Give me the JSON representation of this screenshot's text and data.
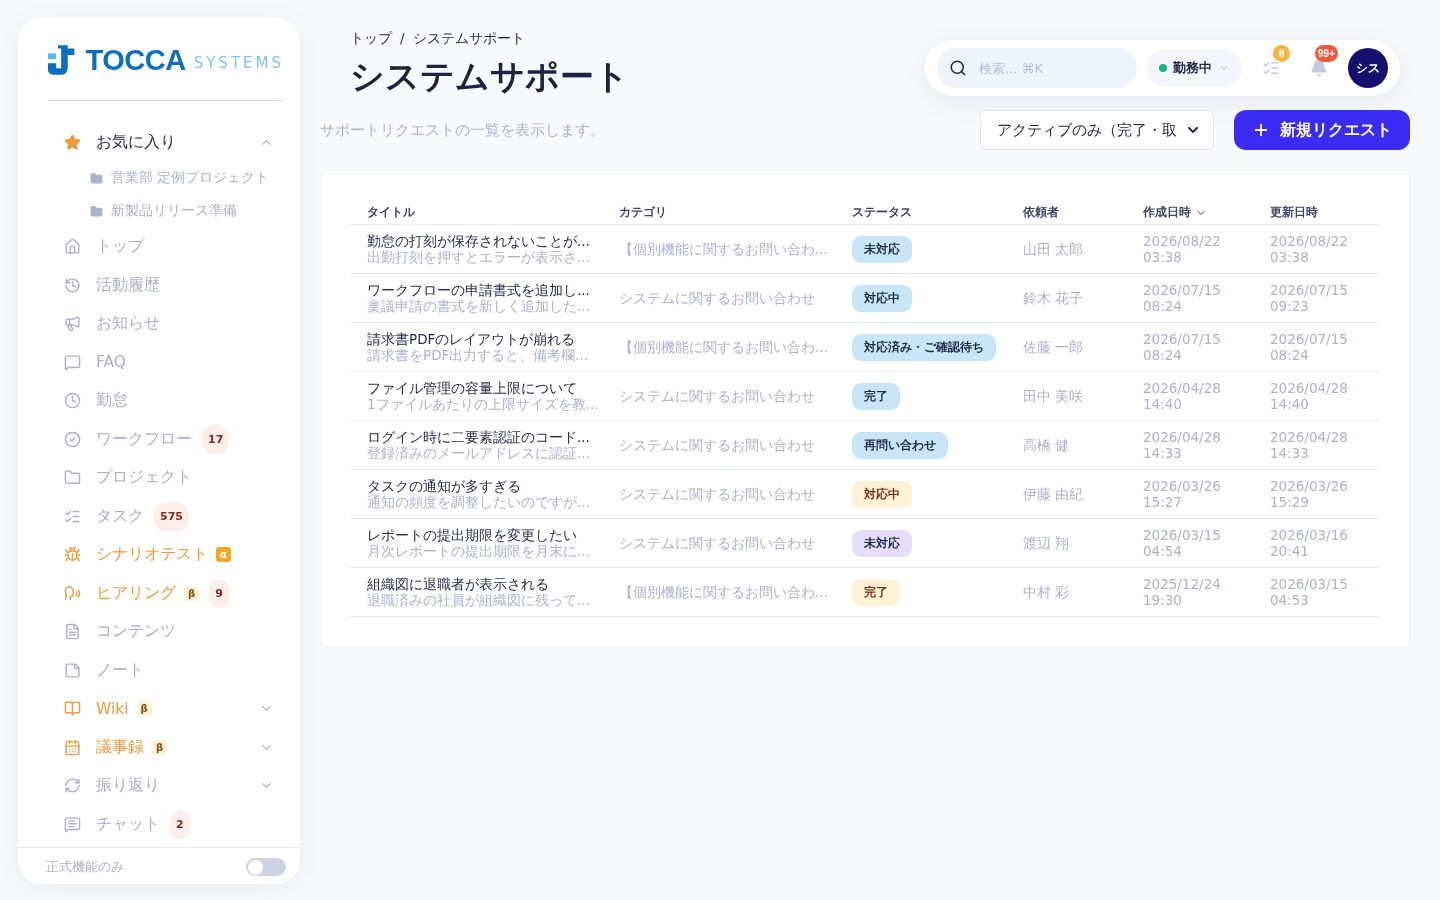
{
  "logo": {
    "brand": "TOCCA",
    "sub": "SYSTEMS"
  },
  "favorites": {
    "label": "お気に入り",
    "expanded": true,
    "children": [
      {
        "label": "営業部 定例プロジェクト"
      },
      {
        "label": "新製品リリース準備"
      }
    ]
  },
  "nav": [
    {
      "label": "トップ",
      "accent": false
    },
    {
      "label": "活動履歴",
      "accent": false
    },
    {
      "label": "お知らせ",
      "accent": false
    },
    {
      "label": "FAQ",
      "accent": false
    },
    {
      "label": "勤怠",
      "accent": false
    },
    {
      "label": "ワークフロー",
      "accent": false,
      "count": "17"
    },
    {
      "label": "プロジェクト",
      "accent": false
    },
    {
      "label": "タスク",
      "accent": false,
      "count": "575"
    },
    {
      "label": "シナリオテスト",
      "accent": true,
      "tag": {
        "label": "α",
        "kind": "solid"
      }
    },
    {
      "label": "ヒアリング",
      "accent": true,
      "tag": {
        "label": "β",
        "kind": "soft"
      },
      "count": "9"
    },
    {
      "label": "コンテンツ",
      "accent": false
    },
    {
      "label": "ノート",
      "accent": false
    },
    {
      "label": "Wiki",
      "accent": true,
      "tag": {
        "label": "β",
        "kind": "soft"
      },
      "expanded": false
    },
    {
      "label": "議事録",
      "accent": true,
      "tag": {
        "label": "β",
        "kind": "soft"
      },
      "expanded": false
    },
    {
      "label": "振り返り",
      "accent": false,
      "expanded": false
    },
    {
      "label": "チャット",
      "accent": false,
      "count": "2"
    }
  ],
  "sidebar_footer": {
    "label": "正式機能のみ",
    "on": false
  },
  "breadcrumb": {
    "items": [
      "トップ",
      "システムサポート"
    ],
    "separator": "/"
  },
  "title": "システムサポート",
  "subtitle": "サポートリクエストの一覧を表示します。",
  "topbar": {
    "search_placeholder": "検索... ⌘K",
    "status": {
      "label": "勤務中",
      "color": "#10b981"
    },
    "task_count": "8",
    "notification_count": "99+",
    "avatar": "シス"
  },
  "filter": "アクティブのみ（完了・取",
  "new_button": "新規リクエスト",
  "table": {
    "columns": [
      {
        "label": "タイトル",
        "sorted": false
      },
      {
        "label": "カテゴリ",
        "sorted": false
      },
      {
        "label": "ステータス",
        "sorted": false
      },
      {
        "label": "依頼者",
        "sorted": false
      },
      {
        "label": "作成日時",
        "sorted": true
      },
      {
        "label": "更新日時",
        "sorted": false
      }
    ],
    "rows": [
      {
        "title": "勤怠の打刻が保存されないことが...",
        "summary": "出勤打刻を押すとエラーが表示さ...",
        "category": "【個別機能に関するお問い合わ...",
        "status": {
          "label": "未対応",
          "color": "#c9e5f8"
        },
        "requester": "山田 太郎",
        "created": {
          "date": "2026/08/22",
          "time": "03:38"
        },
        "updated": {
          "date": "2026/08/22",
          "time": "03:38"
        }
      },
      {
        "title": "ワークフローの申請書式を追加し...",
        "summary": "稟議申請の書式を新しく追加した...",
        "category": "システムに関するお問い合わせ",
        "status": {
          "label": "対応中",
          "color": "#c9e5f8"
        },
        "requester": "鈴木 花子",
        "created": {
          "date": "2026/07/15",
          "time": "08:24"
        },
        "updated": {
          "date": "2026/07/15",
          "time": "09:23"
        }
      },
      {
        "title": "請求書PDFのレイアウトが崩れる",
        "summary": "請求書をPDF出力すると、備考欄...",
        "category": "【個別機能に関するお問い合わ...",
        "status": {
          "label": "対応済み・ご確認待ち",
          "color": "#c9e5f8"
        },
        "requester": "佐藤 一郎",
        "created": {
          "date": "2026/07/15",
          "time": "08:24"
        },
        "updated": {
          "date": "2026/07/15",
          "time": "08:24"
        }
      },
      {
        "title": "ファイル管理の容量上限について",
        "summary": "1ファイルあたりの上限サイズを教...",
        "category": "システムに関するお問い合わせ",
        "status": {
          "label": "完了",
          "color": "#c9e5f8"
        },
        "requester": "田中 美咲",
        "created": {
          "date": "2026/04/28",
          "time": "14:40"
        },
        "updated": {
          "date": "2026/04/28",
          "time": "14:40"
        }
      },
      {
        "title": "ログイン時に二要素認証のコード...",
        "summary": "登録済みのメールアドレスに認証...",
        "category": "システムに関するお問い合わせ",
        "status": {
          "label": "再問い合わせ",
          "color": "#c9e5f8"
        },
        "requester": "高橋 健",
        "created": {
          "date": "2026/04/28",
          "time": "14:33"
        },
        "updated": {
          "date": "2026/04/28",
          "time": "14:33"
        }
      },
      {
        "title": "タスクの通知が多すぎる",
        "summary": "通知の頻度を調整したいのですが...",
        "category": "システムに関するお問い合わせ",
        "status": {
          "label": "対応中",
          "color": "#fdf1d6"
        },
        "requester": "伊藤 由紀",
        "created": {
          "date": "2026/03/26",
          "time": "15:27"
        },
        "updated": {
          "date": "2026/03/26",
          "time": "15:29"
        }
      },
      {
        "title": "レポートの提出期限を変更したい",
        "summary": "月次レポートの提出期限を月末に...",
        "category": "システムに関するお問い合わせ",
        "status": {
          "label": "未対応",
          "color": "#e6dcfb"
        },
        "requester": "渡辺 翔",
        "created": {
          "date": "2026/03/15",
          "time": "04:54"
        },
        "updated": {
          "date": "2026/03/16",
          "time": "20:41"
        }
      },
      {
        "title": "組織図に退職者が表示される",
        "summary": "退職済みの社員が組織図に残って...",
        "category": "【個別機能に関するお問い合わ...",
        "status": {
          "label": "完了",
          "color": "#fdf1d6"
        },
        "requester": "中村 彩",
        "created": {
          "date": "2025/12/24",
          "time": "19:30"
        },
        "updated": {
          "date": "2026/03/15",
          "time": "04:53"
        }
      }
    ]
  }
}
